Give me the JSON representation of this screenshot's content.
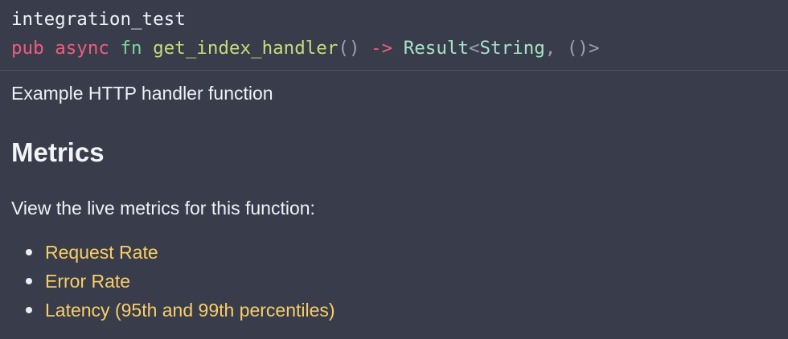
{
  "signature": {
    "module": "integration_test",
    "kw_pub": "pub",
    "kw_async": "async",
    "kw_fn": "fn",
    "fn_name": "get_index_handler",
    "parens": "()",
    "arrow": "->",
    "return_type": "Result",
    "lt": "<",
    "inner_type": "String",
    "comma": ",",
    "unit": "()",
    "gt": ">"
  },
  "doc": {
    "summary": "Example HTTP handler function",
    "heading": "Metrics",
    "intro": "View the live metrics for this function:",
    "links": [
      {
        "label": "Request Rate"
      },
      {
        "label": "Error Rate"
      },
      {
        "label": "Latency (95th and 99th percentiles)"
      }
    ]
  },
  "colors": {
    "background": "#393c4b",
    "keyword": "#ef5e7c",
    "fn_keyword": "#7fd49a",
    "fn_name": "#c8dc7c",
    "type": "#a7e3c8",
    "link": "#f8ce66"
  }
}
